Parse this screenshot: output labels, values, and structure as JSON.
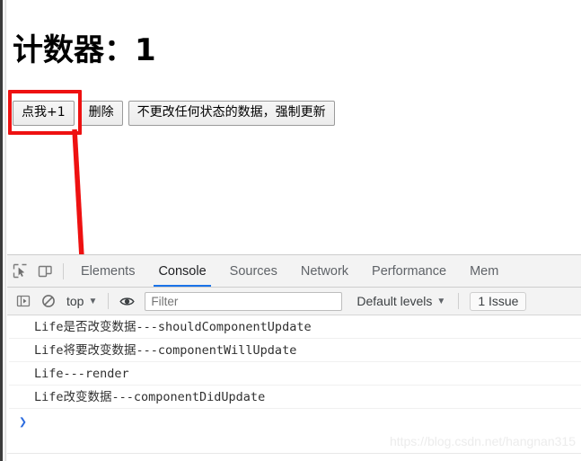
{
  "app": {
    "title": "计数器：1",
    "buttons": [
      {
        "label": "点我+1",
        "name": "increment-button"
      },
      {
        "label": "删除",
        "name": "delete-button"
      },
      {
        "label": "不更改任何状态的数据，强制更新",
        "name": "force-update-button"
      }
    ]
  },
  "annotation": {
    "highlight_color": "#ee1111",
    "arrow_color": "#ee1111"
  },
  "devtools": {
    "icons": {
      "inspect": "inspect-element-icon",
      "device": "device-toolbar-icon",
      "sidebar": "console-sidebar-icon",
      "clear": "clear-console-icon",
      "eye": "live-expression-icon"
    },
    "tabs": [
      {
        "label": "Elements",
        "active": false
      },
      {
        "label": "Console",
        "active": true
      },
      {
        "label": "Sources",
        "active": false
      },
      {
        "label": "Network",
        "active": false
      },
      {
        "label": "Performance",
        "active": false
      },
      {
        "label": "Mem",
        "active": false
      }
    ],
    "active_tab_color": "#1a73e8",
    "console_toolbar": {
      "context": "top",
      "context_caret": "▼",
      "filter_placeholder": "Filter",
      "filter_value": "",
      "levels": "Default levels",
      "levels_caret": "▼",
      "issues": "1 Issue"
    },
    "messages": [
      "Life是否改变数据---shouldComponentUpdate",
      "Life将要改变数据---componentWillUpdate",
      "Life---render",
      "Life改变数据---componentDidUpdate"
    ],
    "prompt": "❯",
    "watermark": "https://blog.csdn.net/hangnan315"
  }
}
